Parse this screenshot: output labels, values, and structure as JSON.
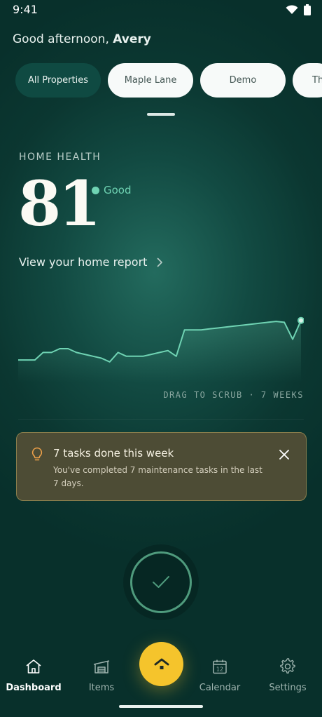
{
  "status_bar": {
    "time": "9:41"
  },
  "greeting": {
    "prefix": "Good afternoon,",
    "name": "Avery"
  },
  "chips": [
    {
      "label": "All Properties",
      "active": true
    },
    {
      "label": "Maple Lane",
      "active": false
    },
    {
      "label": "Demo",
      "active": false
    },
    {
      "label": "Th",
      "active": false
    }
  ],
  "health": {
    "label": "HOME HEALTH",
    "score": "81",
    "status": "Good",
    "report_link": "View your home report"
  },
  "chart_data": {
    "type": "area",
    "values": [
      20,
      20,
      20,
      28,
      28,
      32,
      32,
      28,
      26,
      24,
      22,
      18,
      28,
      24,
      24,
      24,
      26,
      28,
      30,
      24,
      52,
      52,
      52,
      53,
      54,
      55,
      56,
      57,
      58,
      59,
      60,
      61,
      60,
      42,
      62
    ],
    "ylim": [
      0,
      70
    ],
    "line_color": "#6fd3b3",
    "scrub_label": "DRAG TO SCRUB · 7 WEEKS"
  },
  "notice": {
    "title": "7 tasks done this week",
    "body": "You've completed 7 maintenance tasks in the last 7 days.",
    "icon": "lightbulb-icon",
    "accent": "#f0a24a"
  },
  "bottom_nav": {
    "items": [
      {
        "label": "Dashboard",
        "icon": "home-icon",
        "active": true
      },
      {
        "label": "Items",
        "icon": "garage-icon",
        "active": false
      },
      {
        "label": "Calendar",
        "icon": "calendar-icon",
        "active": false,
        "badge": "12"
      },
      {
        "label": "Settings",
        "icon": "gear-icon",
        "active": false
      }
    ],
    "fab_icon": "home-icon",
    "fab_color": "#f5c42c"
  },
  "colors": {
    "accent_green": "#6fd3b3",
    "notice_bg": "#4d4c35",
    "fab": "#f5c42c"
  }
}
